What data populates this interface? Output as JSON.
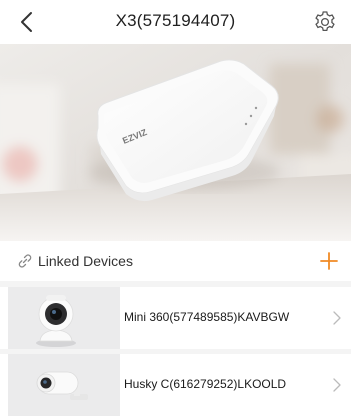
{
  "header": {
    "title": "X3(575194407)",
    "back_icon": "chevron-left-icon",
    "settings_icon": "gear-icon"
  },
  "hero": {
    "logo_text": "EZVIZ"
  },
  "linked_devices": {
    "label": "Linked Devices",
    "link_icon": "link-icon",
    "add_icon": "plus-icon",
    "accent_color": "#f08a24",
    "items": [
      {
        "name": "Mini 360(577489585)KAVBGW",
        "thumb_icon": "dome-camera-icon"
      },
      {
        "name": "Husky C(616279252)LKOOLD",
        "thumb_icon": "bullet-camera-icon"
      }
    ]
  }
}
